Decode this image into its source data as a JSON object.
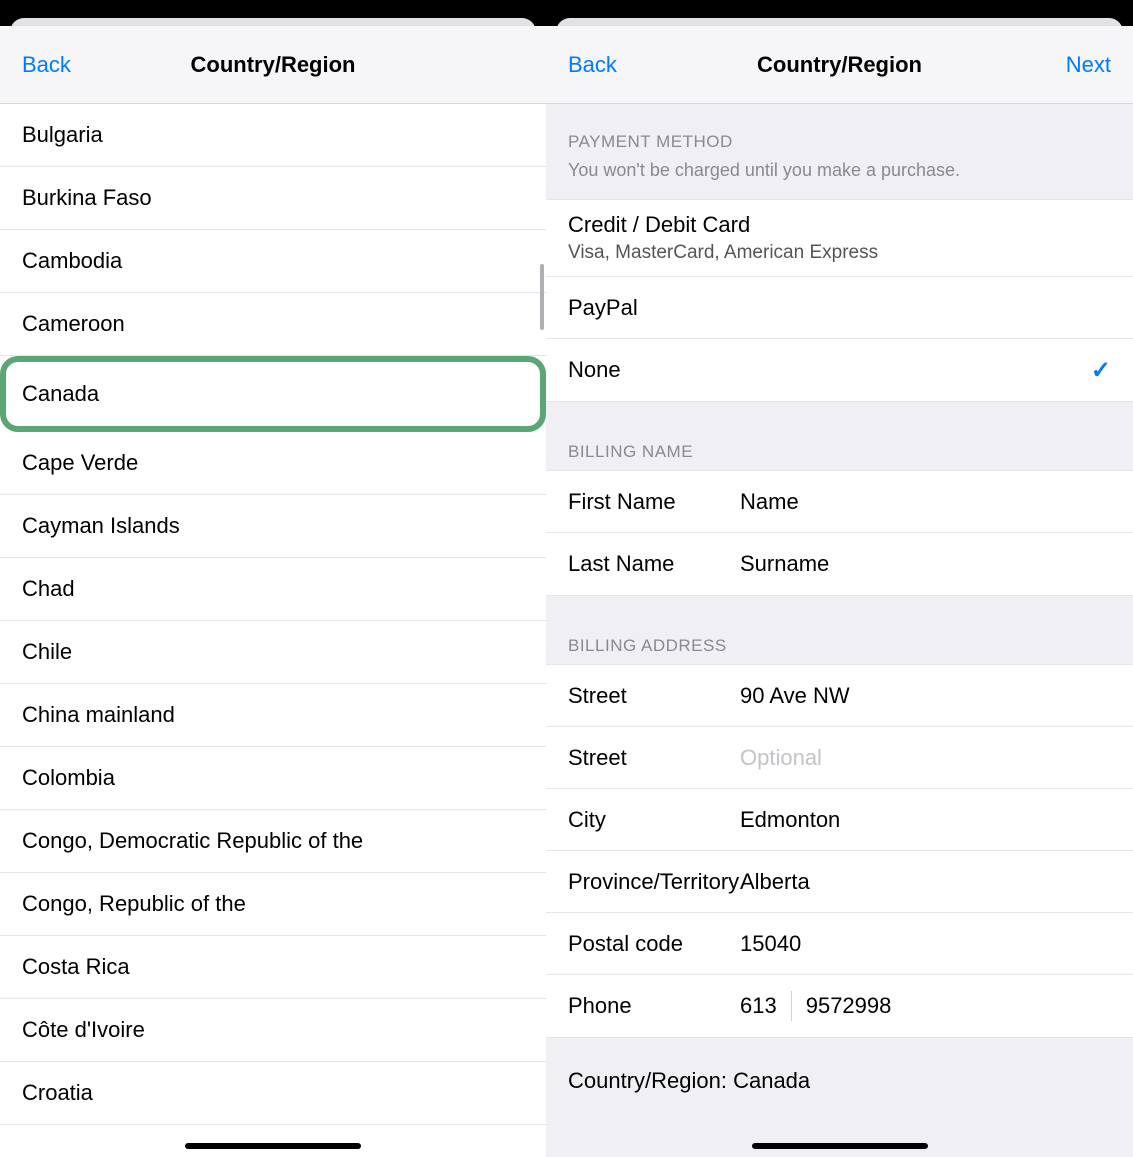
{
  "left": {
    "back": "Back",
    "title": "Country/Region",
    "countries": [
      "Bulgaria",
      "Burkina Faso",
      "Cambodia",
      "Cameroon",
      "Canada",
      "Cape Verde",
      "Cayman Islands",
      "Chad",
      "Chile",
      "China mainland",
      "Colombia",
      "Congo, Democratic Republic of the",
      "Congo, Republic of the",
      "Costa Rica",
      "Côte d'Ivoire",
      "Croatia"
    ],
    "highlighted": "Canada"
  },
  "right": {
    "back": "Back",
    "title": "Country/Region",
    "next": "Next",
    "payment": {
      "header": "PAYMENT METHOD",
      "sub": "You won't be charged until you make a purchase.",
      "options": {
        "card_title": "Credit / Debit Card",
        "card_sub": "Visa, MasterCard, American Express",
        "paypal": "PayPal",
        "none": "None"
      },
      "selected": "None"
    },
    "billing_name": {
      "header": "BILLING NAME",
      "first_label": "First Name",
      "first_value": "Name",
      "last_label": "Last Name",
      "last_value": "Surname"
    },
    "billing_address": {
      "header": "BILLING ADDRESS",
      "street_label": "Street",
      "street_value": "90 Ave NW",
      "street2_label": "Street",
      "street2_placeholder": "Optional",
      "city_label": "City",
      "city_value": "Edmonton",
      "province_label": "Province/Territory",
      "province_value": "Alberta",
      "postal_label": "Postal code",
      "postal_value": "15040",
      "phone_label": "Phone",
      "phone_prefix": "613",
      "phone_number": "9572998"
    },
    "footer": "Country/Region: Canada"
  }
}
